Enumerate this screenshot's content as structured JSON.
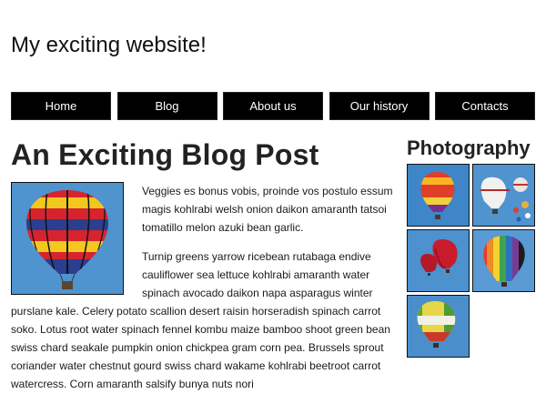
{
  "header": {
    "site_title": "My exciting website!"
  },
  "nav": {
    "items": [
      {
        "label": "Home"
      },
      {
        "label": "Blog"
      },
      {
        "label": "About us"
      },
      {
        "label": "Our history"
      },
      {
        "label": "Contacts"
      }
    ]
  },
  "main": {
    "post_title": "An Exciting Blog Post",
    "paragraphs": [
      "Veggies es bonus vobis, proinde vos postulo essum magis kohlrabi welsh onion daikon amaranth tatsoi tomatillo melon azuki bean garlic.",
      "Turnip greens yarrow ricebean rutabaga endive cauliflower sea lettuce kohlrabi amaranth water spinach avocado daikon napa asparagus winter purslane kale. Celery potato scallion desert raisin horseradish spinach carrot soko. Lotus root water spinach fennel kombu maize bamboo shoot green bean swiss chard seakale pumpkin onion chickpea gram corn pea. Brussels sprout coriander water chestnut gourd swiss chard wakame kohlrabi beetroot carrot watercress. Corn amaranth salsify bunya nuts nori"
    ]
  },
  "sidebar": {
    "title": "Photography",
    "photos": [
      {
        "icon": "balloon-photo"
      },
      {
        "icon": "balloon-photo"
      },
      {
        "icon": "balloon-photo"
      },
      {
        "icon": "balloon-photo"
      },
      {
        "icon": "balloon-photo"
      }
    ]
  },
  "colors": {
    "nav_background": "#000000",
    "nav_text": "#ffffff",
    "sky": "#4f93cf",
    "text": "#222222"
  }
}
